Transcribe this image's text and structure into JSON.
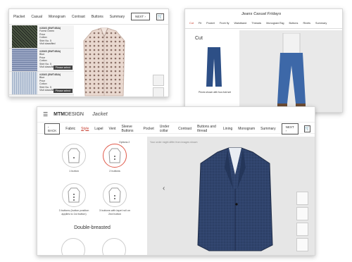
{
  "shirt": {
    "tabs": [
      "Placket",
      "Casual",
      "Monogram",
      "Contrast",
      "Buttons",
      "Summary"
    ],
    "next_label": "NEXT",
    "cart_icon": "cart-icon",
    "fabrics": [
      {
        "lines": [
          "#1S4S (SWT4SIA)",
          "Forest Green",
          "Price",
          "Cotton",
          "Shirt No. 5",
          "Visit classified"
        ],
        "button": "",
        "color": "#3a3f35"
      },
      {
        "lines": [
          "#1S4S (SWT4SIA)",
          "Blue",
          "Price",
          "Cotton",
          "Shirt No. 5",
          "Visit classified"
        ],
        "button": "Please select",
        "color": "#7b88a8"
      },
      {
        "lines": [
          "#1S4S (SWT4SIA)",
          "Blue",
          "Price",
          "Cotton",
          "Shirt No. 5",
          "Visit classified"
        ],
        "button": "Please select",
        "color": "#a6b3c6"
      },
      {
        "lines": [
          "#1S4S (SWT4SIA)",
          "Pink",
          "Price",
          "Cotton",
          "Shirt No. 5",
          "Visit classified"
        ],
        "button": "Please select",
        "color": "#e6c9c0"
      }
    ]
  },
  "jeans": {
    "title": "Jeans Casual Fridays",
    "tabs": [
      "Cut",
      "Fit",
      "Pocket",
      "Front fly",
      "Waistband",
      "Threads",
      "Monogram/Tag",
      "Buttons",
      "Rivets",
      "Summary"
    ],
    "section": "Cut",
    "caption": "Prices shown with four-fold set"
  },
  "jacket": {
    "logo_bold": "MTM",
    "logo_regular": "DESIGN",
    "product": "Jacket",
    "back_label": "BACK",
    "nav": [
      "Fabric",
      "Style",
      "Lapel",
      "Vent",
      "Sleeve Buttons",
      "Pocket",
      "Under collar",
      "Contrast",
      "Buttons and thread",
      "Lining",
      "Monogram",
      "Summary"
    ],
    "active_nav": "Style",
    "next_label": "NEXT",
    "options": [
      {
        "label": "1 button"
      },
      {
        "label": "2 buttons",
        "tag": "Options 2"
      },
      {
        "label": "3 buttons (button position applies to 1st button)"
      },
      {
        "label": "3 buttons with lapel roll on 2nd button"
      }
    ],
    "section_title": "Double-breasted",
    "stage_note": "Your order might differ from images shown"
  }
}
